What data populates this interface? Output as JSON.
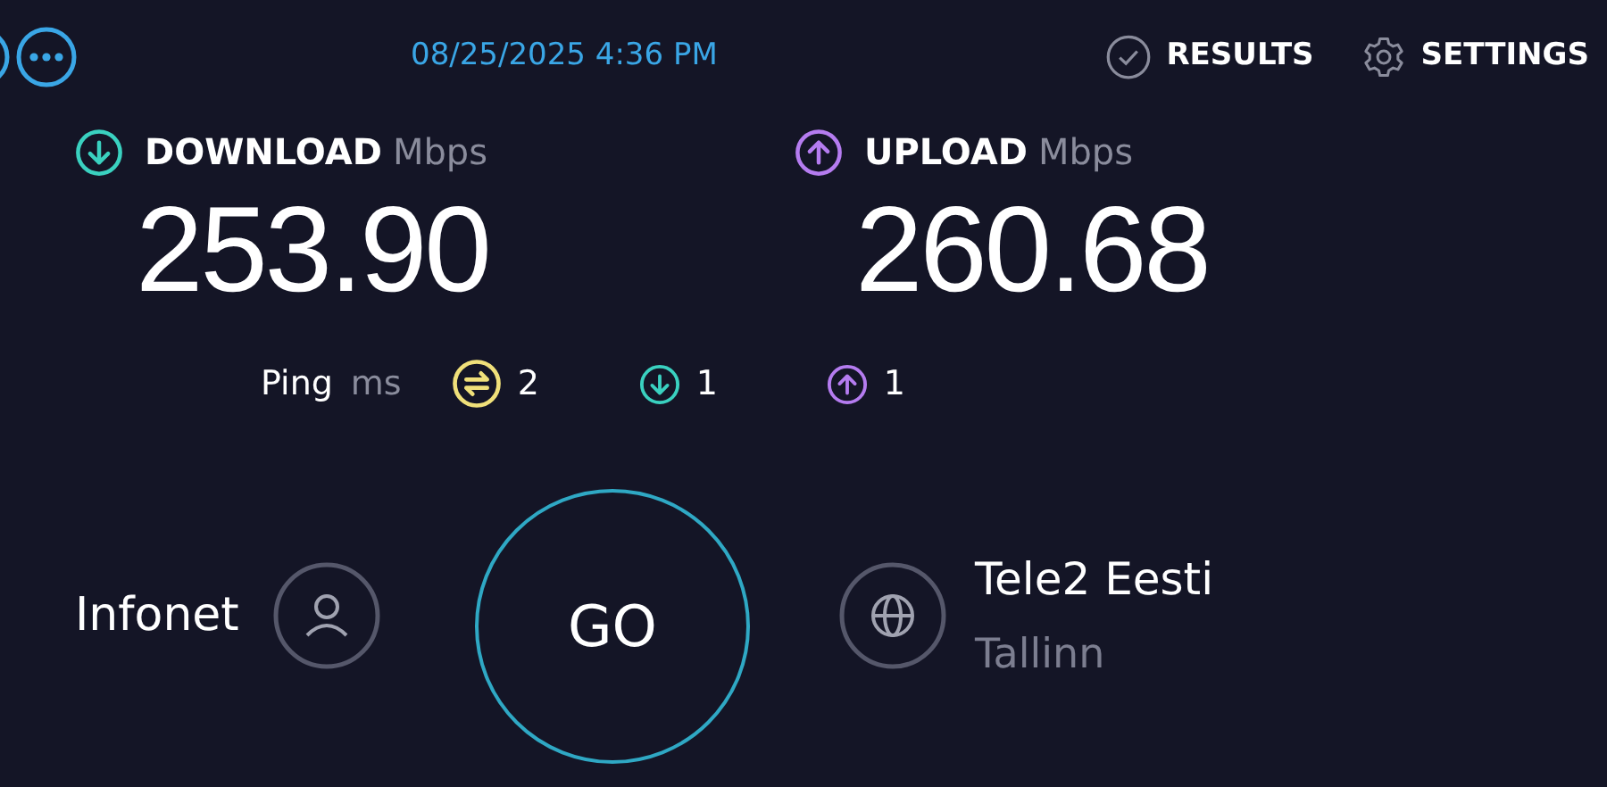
{
  "header": {
    "date": "08/25/2025 4:36 PM",
    "nav": [
      {
        "kind": "results",
        "label": "RESULTS"
      },
      {
        "kind": "settings",
        "label": "SETTINGS"
      }
    ]
  },
  "metrics": [
    {
      "kind": "download",
      "label": "DOWNLOAD",
      "unit": "Mbps",
      "value": "253.90",
      "color": "#3ad1c0"
    },
    {
      "kind": "upload",
      "label": "UPLOAD",
      "unit": "Mbps",
      "value": "260.68",
      "color": "#b57cf0"
    }
  ],
  "ping": {
    "label": "Ping",
    "unit": "ms",
    "items": [
      {
        "kind": "idle",
        "value": "2",
        "color": "#f0e07a"
      },
      {
        "kind": "download",
        "value": "1",
        "color": "#3ad1c0"
      },
      {
        "kind": "upload",
        "value": "1",
        "color": "#b57cf0"
      }
    ]
  },
  "isp": {
    "name": "Infonet"
  },
  "go": {
    "label": "GO"
  },
  "server": {
    "name": "Tele2 Eesti",
    "location": "Tallinn"
  }
}
